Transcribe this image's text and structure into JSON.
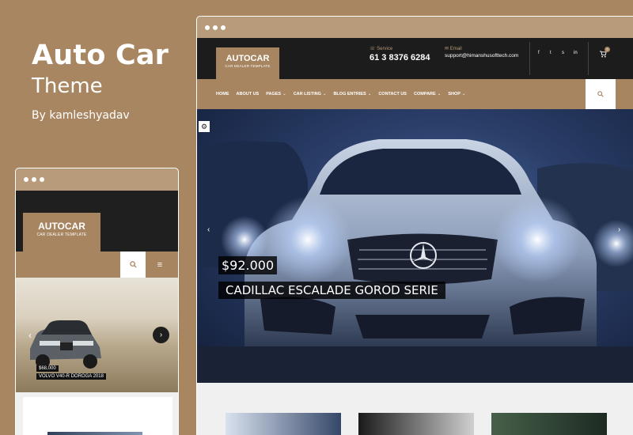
{
  "promo": {
    "title": "Auto Car",
    "subtitle": "Theme",
    "author": "By kamleshyadav"
  },
  "colors": {
    "background": "#a98662",
    "brand": "#a78560",
    "header_dark": "#1c1c1c"
  },
  "mobile": {
    "logo": {
      "name": "AUTOCAR",
      "tagline": "CAR DEALER TEMPLATE"
    },
    "search_icon": "search-icon",
    "menu_icon": "menu-icon",
    "slide": {
      "price": "$68,000",
      "name": "VOLVO V40-R DOROGA 2018"
    }
  },
  "desktop": {
    "logo": {
      "name": "AUTOCAR",
      "tagline": "CAR DEALER TEMPLATE"
    },
    "service": {
      "label": "Service",
      "value": "61 3 8376 6284"
    },
    "email": {
      "label": "Email",
      "value": "support@himanshusofttech.com"
    },
    "social": [
      "f",
      "t",
      "s",
      "in"
    ],
    "cart_count": "0",
    "nav": [
      "HOME",
      "ABOUT US",
      "PAGES",
      "CAR LISTING",
      "BLOG ENTRIES",
      "CONTACT US",
      "COMPARE",
      "SHOP"
    ],
    "nav_dropdown": [
      false,
      false,
      true,
      true,
      true,
      false,
      true,
      true
    ],
    "slide": {
      "price": "$92.000",
      "name": "CADILLAC ESCALADE GOROD SERIE"
    }
  }
}
